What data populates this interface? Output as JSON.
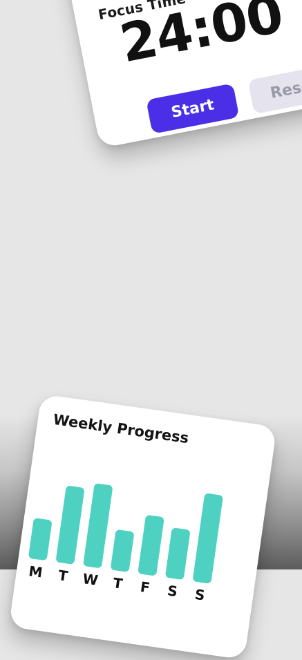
{
  "focus": {
    "title": "Focus Time",
    "timer": "24:00",
    "start_label": "Start",
    "reset_label": "Reset"
  },
  "weekly": {
    "title": "Weekly Progress",
    "days": [
      "M",
      "T",
      "W",
      "T",
      "F",
      "S",
      "S"
    ],
    "relative_values": [
      0.45,
      0.85,
      0.92,
      0.45,
      0.65,
      0.55,
      0.98
    ]
  },
  "colors": {
    "accent": "#4a2fe6",
    "bar": "#4fd1c2",
    "reset_bg": "#e5e4ee"
  }
}
